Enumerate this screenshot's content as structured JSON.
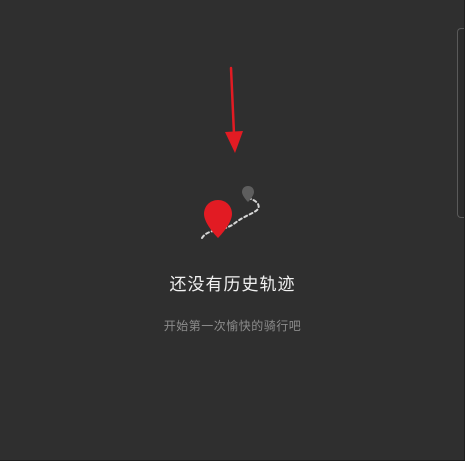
{
  "empty_state": {
    "title": "还没有历史轨迹",
    "subtitle": "开始第一次愉快的骑行吧",
    "illustration_icon": "route-map-pin-icon"
  },
  "annotation": {
    "icon": "red-arrow-icon",
    "color": "#e21b23"
  },
  "colors": {
    "background": "#2f2f2f",
    "pin_primary": "#e21b23",
    "pin_secondary": "#5e5e5e",
    "route_dash": "#d6d6d6"
  }
}
